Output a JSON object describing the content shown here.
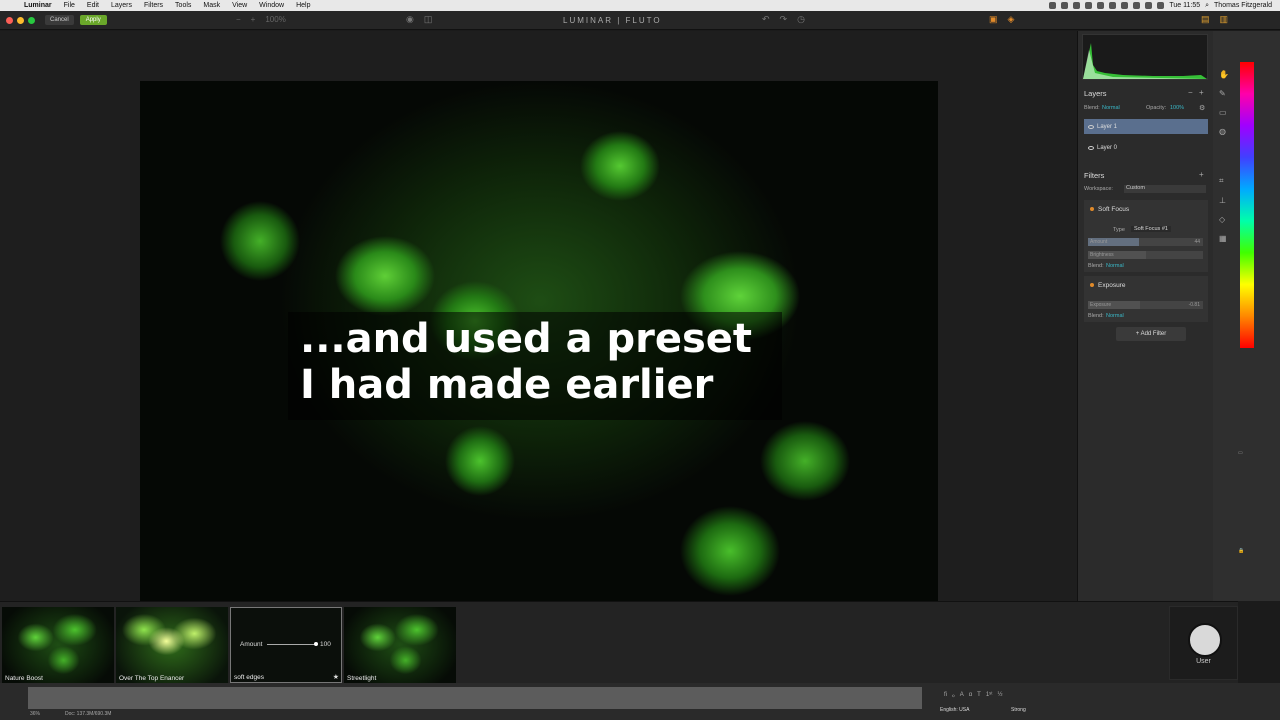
{
  "menubar": {
    "app": "Luminar",
    "items": [
      "File",
      "Edit",
      "Layers",
      "Filters",
      "Tools",
      "Mask",
      "View",
      "Window",
      "Help"
    ],
    "time": "Tue 11:55",
    "user": "Thomas Fitzgerald"
  },
  "toolbar": {
    "cancel": "Cancel",
    "apply": "Apply",
    "zoom_minus": "−",
    "zoom_plus": "+",
    "zoom_value": "100%",
    "logo": "LUMINAR | FLUTO"
  },
  "caption": {
    "line1": "...and used a preset",
    "line2": "I had made earlier"
  },
  "panel": {
    "layers_title": "Layers",
    "blend_label": "Blend:",
    "blend_value": "Normal",
    "opacity_label": "Opacity:",
    "opacity_value": "100%",
    "layers": [
      "Layer 1",
      "Layer 0"
    ],
    "filters_title": "Filters",
    "workspace_label": "Workspace:",
    "workspace_value": "Custom",
    "soft_focus": {
      "name": "Soft Focus",
      "type_label": "Type",
      "type_value": "Soft Focus #1",
      "amount_label": "Amount",
      "amount_value": "44",
      "amount_fraction": 0.44,
      "brightness_label": "Brightness",
      "brightness_fraction": 0.5,
      "blend_label": "Blend:",
      "blend_value": "Normal"
    },
    "exposure": {
      "name": "Exposure",
      "exposure_label": "Exposure",
      "exposure_value": "-0.81",
      "exposure_fraction": 0.45,
      "blend_label": "Blend:",
      "blend_value": "Normal"
    },
    "add_filter": "Add Filter"
  },
  "filmstrip": {
    "presets": [
      "Nature Boost",
      "Over The Top Enancer",
      "soft edges",
      "Streetlight"
    ],
    "selected_amount_label": "Amount",
    "selected_amount_value": "100"
  },
  "user": {
    "label": "User"
  },
  "bottom": {
    "zoom": "36%",
    "doc": "Doc: 137.3M/690.3M",
    "language": "English: USA",
    "aa": "Strong"
  },
  "colors": {
    "apply": "#6aa72a",
    "active_layer": "#5a6f8e",
    "teal_text": "#3ab8c8",
    "filter_dot": "#e08a2a"
  }
}
